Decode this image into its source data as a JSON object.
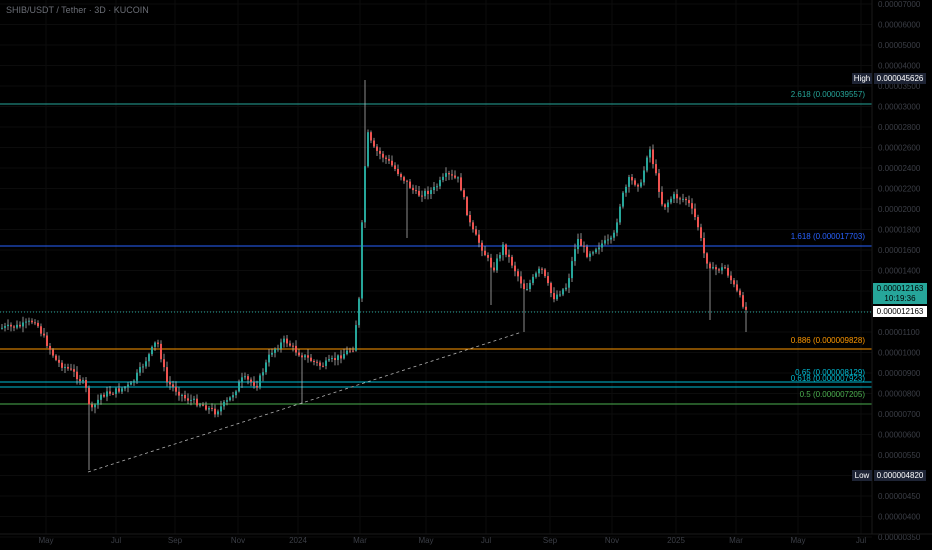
{
  "header": {
    "title": "SHIB/USDT / Tether · 3D · KUCOIN"
  },
  "price_axis": {
    "ticks": [
      "0.00007000",
      "0.00006000",
      "0.00005000",
      "0.00004000",
      "0.00003500",
      "0.00003000",
      "0.00002800",
      "0.00002600",
      "0.00002400",
      "0.00002200",
      "0.00002000",
      "0.00001800",
      "0.00001600",
      "0.00001400",
      "0.00001300",
      "0.00001200",
      "0.00001100",
      "0.00001000",
      "0.00000900",
      "0.00000800",
      "0.00000700",
      "0.00000600",
      "0.00000550",
      "0.00000500",
      "0.00000450",
      "0.00000400",
      "0.00000350"
    ]
  },
  "time_axis": {
    "labels": [
      "May",
      "Jul",
      "Sep",
      "Nov",
      "2024",
      "Mar",
      "May",
      "Jul",
      "Sep",
      "Nov",
      "2025",
      "Mar",
      "May",
      "Jul"
    ]
  },
  "tags": {
    "high_label": "High",
    "high_value": "0.000045626",
    "low_label": "Low",
    "low_value": "0.000004820",
    "last_price": "0.000012163",
    "countdown": "10:19:36",
    "last_price_2": "0.000012163"
  },
  "levels": [
    {
      "label": "2.618 (0.000039557)",
      "color": "#26a69a"
    },
    {
      "label": "1.618 (0.000017703)",
      "color": "#2962ff"
    },
    {
      "label": "0.886 (0.000009828)",
      "color": "#ff9800"
    },
    {
      "label": "0.65 (0.000008129)",
      "color": "#00bcd4"
    },
    {
      "label": "0.618 (0.000007923)",
      "color": "#00bcd4"
    },
    {
      "label": "0.5 (0.000007205)",
      "color": "#4caf50"
    }
  ],
  "colors": {
    "up": "#26a69a",
    "down": "#ef5350",
    "wick": "#c8c8c8",
    "trendline": "#b0b0b0",
    "bg": "#000000"
  },
  "chart_data": {
    "type": "candlestick",
    "title": "SHIB/USDT / Tether · 3D · KUCOIN",
    "x": [
      "2023-05",
      "2023-06",
      "2023-07",
      "2023-08",
      "2023-09",
      "2023-10",
      "2023-11",
      "2023-12",
      "2024-01",
      "2024-02",
      "2024-03",
      "2024-04",
      "2024-05",
      "2024-06",
      "2024-07",
      "2024-08",
      "2024-09",
      "2024-10",
      "2024-11",
      "2024-12",
      "2025-01",
      "2025-02",
      "2025-03"
    ],
    "close": [
      9.8e-06,
      8e-06,
      7.6e-06,
      8.2e-06,
      7.3e-06,
      7e-06,
      8.3e-06,
      1.05e-05,
      9.7e-06,
      9.8e-06,
      2.7e-05,
      2.5e-05,
      2.4e-05,
      1.85e-05,
      1.7e-05,
      1.4e-05,
      1.8e-05,
      1.78e-05,
      2.5e-05,
      2.8e-05,
      2.3e-05,
      1.55e-05,
      1.22e-05
    ],
    "high": 4.5626e-05,
    "low": 4.82e-06,
    "last": 1.2163e-05,
    "fib_levels": [
      {
        "ratio": 2.618,
        "price": 3.9557e-05
      },
      {
        "ratio": 1.618,
        "price": 1.7703e-05
      },
      {
        "ratio": 0.886,
        "price": 9.828e-06
      },
      {
        "ratio": 0.65,
        "price": 8.129e-06
      },
      {
        "ratio": 0.618,
        "price": 7.923e-06
      },
      {
        "ratio": 0.5,
        "price": 7.205e-06
      }
    ],
    "yscale": "log"
  }
}
